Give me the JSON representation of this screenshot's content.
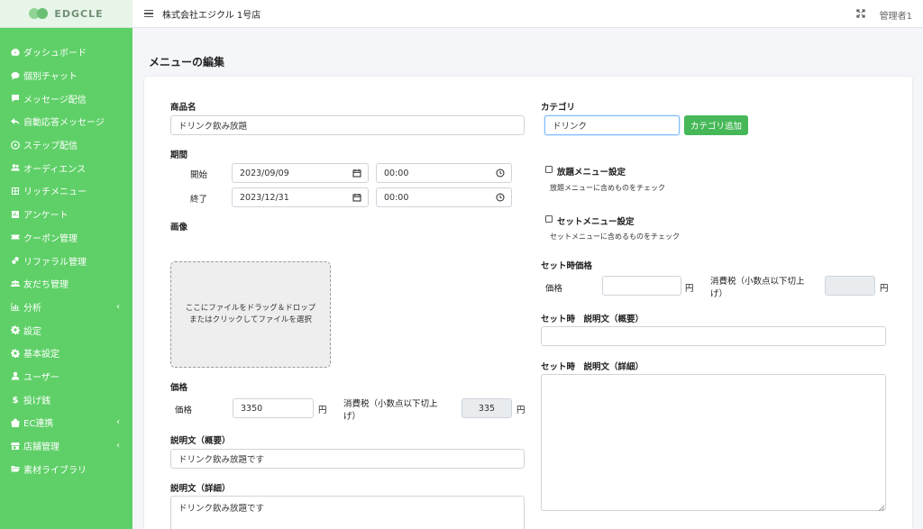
{
  "brand": {
    "name": "EDGCLE"
  },
  "topbar": {
    "store_name": "株式会社エジクル 1号店",
    "user": "管理者1"
  },
  "sidebar": {
    "items": [
      {
        "label": "ダッシュボード",
        "icon": "dashboard-icon"
      },
      {
        "label": "個別チャット",
        "icon": "chat-icon"
      },
      {
        "label": "メッセージ配信",
        "icon": "message-icon"
      },
      {
        "label": "自動応答メッセージ",
        "icon": "reply-icon"
      },
      {
        "label": "ステップ配信",
        "icon": "play-circle-icon"
      },
      {
        "label": "オーディエンス",
        "icon": "users-icon"
      },
      {
        "label": "リッチメニュー",
        "icon": "grid-icon"
      },
      {
        "label": "アンケート",
        "icon": "poll-icon"
      },
      {
        "label": "クーポン管理",
        "icon": "ticket-icon"
      },
      {
        "label": "リファラル管理",
        "icon": "link-icon"
      },
      {
        "label": "友だち管理",
        "icon": "friends-icon"
      },
      {
        "label": "分析",
        "icon": "chart-icon",
        "has_submenu": true
      },
      {
        "label": "設定",
        "icon": "gear-icon"
      },
      {
        "label": "基本設定",
        "icon": "gear-icon"
      },
      {
        "label": "ユーザー",
        "icon": "user-icon"
      },
      {
        "label": "投げ銭",
        "icon": "dollar-icon"
      },
      {
        "label": "EC連携",
        "icon": "bag-icon",
        "has_submenu": true
      },
      {
        "label": "店舗管理",
        "icon": "store-icon",
        "has_submenu": true
      },
      {
        "label": "素材ライブラリ",
        "icon": "folder-icon"
      }
    ]
  },
  "page": {
    "title": "メニューの編集"
  },
  "form": {
    "product_name_label": "商品名",
    "product_name_value": "ドリンク飲み放題",
    "period_label": "期間",
    "start_label": "開始",
    "start_date": "2023/09/09",
    "start_time": "00:00",
    "end_label": "終了",
    "end_date": "2023/12/31",
    "end_time": "00:00",
    "image_label": "画像",
    "dropzone_line1": "ここにファイルをドラッグ＆ドロップ",
    "dropzone_line2": "またはクリックしてファイルを選択",
    "price_section_label": "価格",
    "price_label": "価格",
    "price_value": "3350",
    "yen": "円",
    "tax_label_line1": "消費税（小数点以下切上",
    "tax_label_line2": "げ）",
    "tax_value": "335",
    "desc_summary_label": "説明文（概要）",
    "desc_summary_value": "ドリンク飲み放題です",
    "desc_detail_label": "説明文（詳細）",
    "desc_detail_value": "ドリンク飲み放題です",
    "category_label": "カテゴリ",
    "category_value": "ドリンク",
    "category_add_button": "カテゴリ追加",
    "all_you_can_label": "放題メニュー設定",
    "all_you_can_help": "放題メニューに含めものをチェック",
    "set_menu_label": "セットメニュー設定",
    "set_menu_help": "セットメニューに含めるものをチェック",
    "set_price_section_label": "セット時価格",
    "set_price_label": "価格",
    "set_price_value": "",
    "set_tax_value": "",
    "set_desc_summary_label": "セット時　説明文（概要）",
    "set_desc_summary_value": "",
    "set_desc_detail_label": "セット時　説明文（詳細）",
    "set_desc_detail_value": ""
  },
  "colors": {
    "sidebar": "#5fd068",
    "button": "#46b858"
  }
}
